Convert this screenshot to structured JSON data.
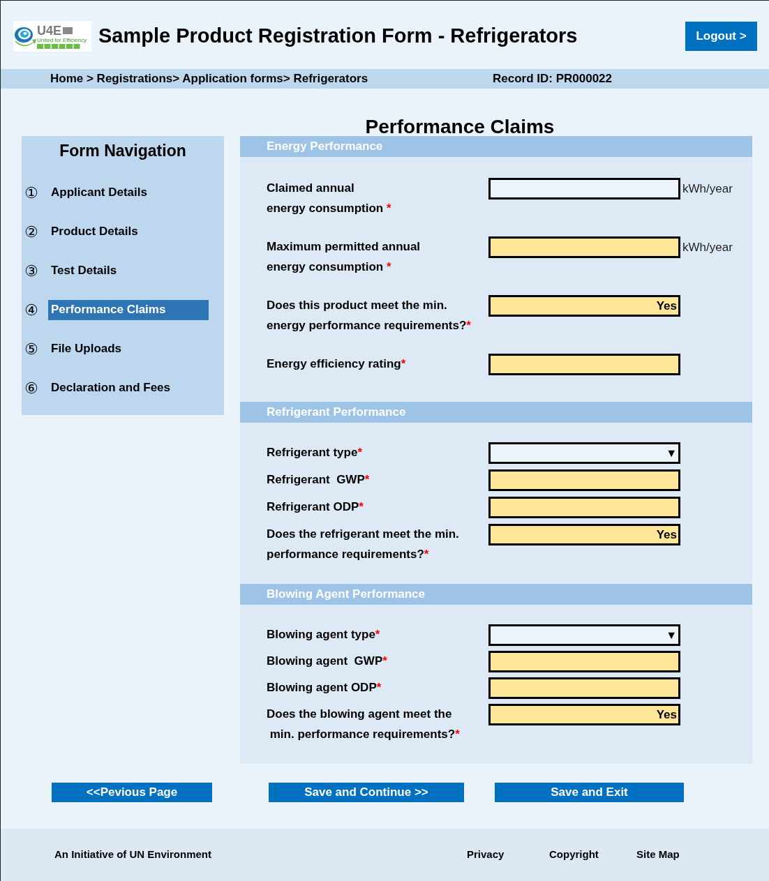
{
  "logo": {
    "mark": "U4E",
    "tagline": "United for Efficiency"
  },
  "title": "Sample Product Registration Form - Refrigerators",
  "logout": "Logout >",
  "breadcrumb": "Home > Registrations> Application forms> Refrigerators",
  "record_id": "Record ID: PR000022",
  "page_title": "Performance Claims",
  "navigation": {
    "title": "Form Navigation",
    "items": [
      {
        "number": "①",
        "label": "Applicant Details",
        "selected": false
      },
      {
        "number": "②",
        "label": "Product Details",
        "selected": false
      },
      {
        "number": "③",
        "label": "Test Details",
        "selected": false
      },
      {
        "number": "④",
        "label": "Performance Claims",
        "selected": true
      },
      {
        "number": "⑤",
        "label": "File Uploads",
        "selected": false
      },
      {
        "number": "⑥",
        "label": "Declaration and Fees",
        "selected": false
      }
    ]
  },
  "sections": [
    {
      "title": "Energy Performance",
      "fields": [
        {
          "label": [
            "Claimed annual",
            "energy consumption "
          ],
          "mark": "*",
          "kind": "input",
          "unit": "kWh/year"
        },
        {
          "label": [
            "Maximum permitted annual",
            "energy consumption "
          ],
          "mark": "*",
          "kind": "computed",
          "unit": "kWh/year"
        },
        {
          "label": [
            "Does this product meet the min.",
            "energy performance requirements?"
          ],
          "mark": "*",
          "kind": "computed",
          "value": "Yes"
        },
        {
          "label": [
            "Energy efficiency rating"
          ],
          "mark": "*",
          "kind": "computed"
        }
      ]
    },
    {
      "title": "Refrigerant Performance",
      "fields": [
        {
          "label": [
            "Refrigerant type"
          ],
          "mark": "*",
          "kind": "select",
          "arrow": "▼"
        },
        {
          "label": [
            "Refrigerant  GWP"
          ],
          "mark": "*",
          "kind": "computed"
        },
        {
          "label": [
            "Refrigerant ODP"
          ],
          "mark": "*",
          "kind": "computed"
        },
        {
          "label": [
            "Does the refrigerant meet the min.",
            "performance requirements?"
          ],
          "mark": "*",
          "kind": "computed",
          "value": "Yes"
        }
      ]
    },
    {
      "title": "Blowing Agent Performance",
      "fields": [
        {
          "label": [
            "Blowing agent type"
          ],
          "mark": "*",
          "kind": "select",
          "arrow": "▼"
        },
        {
          "label": [
            "Blowing agent  GWP"
          ],
          "mark": "*",
          "kind": "computed"
        },
        {
          "label": [
            "Blowing agent ODP"
          ],
          "mark": "*",
          "kind": "computed"
        },
        {
          "label": [
            "Does the blowing agent meet the",
            " min. performance requirements?"
          ],
          "mark": "*",
          "kind": "computed",
          "value": "Yes"
        }
      ]
    }
  ],
  "buttons": [
    "<<Pevious Page",
    "Save and Continue >>",
    "Save and Exit"
  ],
  "footer": {
    "text": "An Initiative of UN Environment",
    "links": [
      "Privacy",
      "Copyright",
      "Site Map"
    ]
  }
}
